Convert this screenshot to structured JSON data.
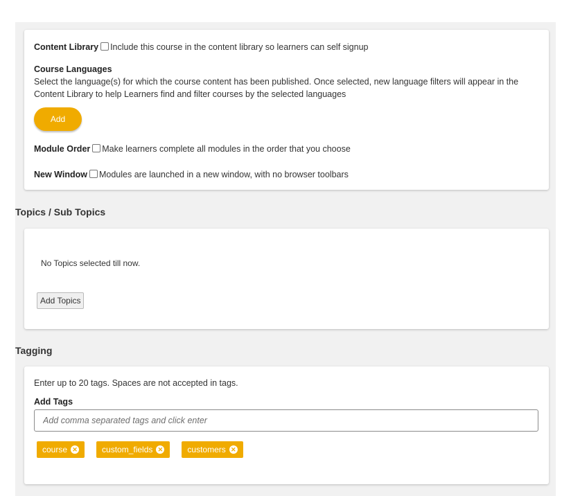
{
  "settings": {
    "content_library": {
      "label": "Content Library",
      "description": "Include this course in the content library so learners can self signup",
      "checked": false
    },
    "course_languages": {
      "label": "Course Languages",
      "description": "Select the language(s) for which the course content has been published. Once selected, new language filters will appear in the Content Library to help Learners find and filter courses by the selected languages",
      "add_label": "Add"
    },
    "module_order": {
      "label": "Module Order",
      "description": "Make learners complete all modules in the order that you choose",
      "checked": false
    },
    "new_window": {
      "label": "New Window",
      "description": "Modules are launched in a new window, with no browser toolbars",
      "checked": false
    }
  },
  "topics": {
    "title": "Topics / Sub Topics",
    "empty_text": "No Topics selected till now.",
    "add_topics_label": "Add Topics"
  },
  "tagging": {
    "title": "Tagging",
    "hint": "Enter up to 20 tags. Spaces are not accepted in tags.",
    "add_tags_label": "Add Tags",
    "input_placeholder": "Add comma separated tags and click enter",
    "input_value": "",
    "tags": [
      {
        "label": "course"
      },
      {
        "label": "custom_fields"
      },
      {
        "label": "customers"
      }
    ]
  },
  "colors": {
    "accent": "#f0ab00",
    "background": "#f1f1f1",
    "card": "#ffffff"
  }
}
